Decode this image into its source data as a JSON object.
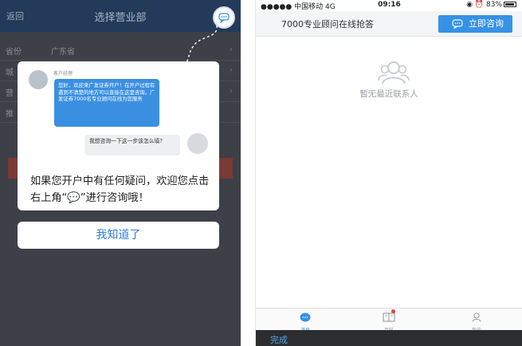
{
  "left": {
    "nav": {
      "back": "返回",
      "title": "选择营业部"
    },
    "rows": [
      {
        "label": "省份",
        "value": "广东省"
      },
      {
        "label": "城",
        "value": ""
      },
      {
        "label": "营",
        "value": ""
      },
      {
        "label": "推",
        "value": ""
      }
    ],
    "modal": {
      "agent_name": "客户经理",
      "agent_msg": "您好，欢迎来广发证券开户！在开户过程有遇到不清楚的地方可以直接在这里咨询。广发证券7000名专业顾问在线为您服务",
      "user_msg": "我想咨询一下这一步该怎么填?",
      "tip": "如果您开户中有任何疑问，欢迎您点击右上角“💬”进行咨询哦！"
    },
    "ok_button": "我知道了",
    "help_icon": "chat-bubble-icon"
  },
  "right": {
    "status": {
      "carrier": "●●●●● 中国移动  4G",
      "time": "09:16",
      "battery": "◉ ⏰ 83%"
    },
    "header_text": "7000专业顾问在线抢答",
    "consult_button": "立即咨询",
    "empty_text": "暂无最近联系人",
    "tabs": [
      {
        "label": "消息",
        "icon": "message-icon",
        "active": true
      },
      {
        "label": "百科",
        "icon": "encyclopedia-icon",
        "active": false,
        "badge": true
      },
      {
        "label": "我的",
        "icon": "profile-icon",
        "active": false
      }
    ],
    "keyboard_done": "完成"
  },
  "colors": {
    "accent": "#3592e6",
    "bubble": "#3a8fe0",
    "overlay": "#3d4046",
    "badge": "#e5453a"
  }
}
